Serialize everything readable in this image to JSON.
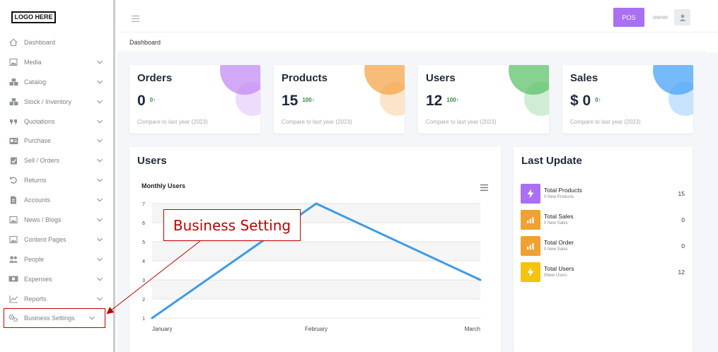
{
  "logo": "LOGO HERE",
  "sidebar": {
    "items": [
      {
        "label": "Dashboard",
        "icon": "home-icon",
        "has_chevron": false
      },
      {
        "label": "Media",
        "icon": "image-icon",
        "has_chevron": true
      },
      {
        "label": "Catalog",
        "icon": "boxes-icon",
        "has_chevron": true
      },
      {
        "label": "Stock / Inventory",
        "icon": "boxes-icon",
        "has_chevron": true
      },
      {
        "label": "Quotations",
        "icon": "quote-icon",
        "has_chevron": true
      },
      {
        "label": "Purchase",
        "icon": "id-card-icon",
        "has_chevron": true
      },
      {
        "label": "Sell / Orders",
        "icon": "clipboard-check-icon",
        "has_chevron": true
      },
      {
        "label": "Returns",
        "icon": "undo-icon",
        "has_chevron": true
      },
      {
        "label": "Accounts",
        "icon": "file-icon",
        "has_chevron": true
      },
      {
        "label": "News / Blogs",
        "icon": "image-icon",
        "has_chevron": true
      },
      {
        "label": "Content Pages",
        "icon": "image-icon",
        "has_chevron": true
      },
      {
        "label": "People",
        "icon": "users-icon",
        "has_chevron": true
      },
      {
        "label": "Expenses",
        "icon": "money-icon",
        "has_chevron": true
      },
      {
        "label": "Reports",
        "icon": "chart-line-icon",
        "has_chevron": true
      },
      {
        "label": "Business Settings",
        "icon": "cogs-icon",
        "has_chevron": true
      }
    ]
  },
  "topbar": {
    "pos_label": "POS",
    "user_label": "owner"
  },
  "breadcrumb": "Dashboard",
  "stats": [
    {
      "title": "Orders",
      "value": "0",
      "delta": "0↑",
      "footer": "Compare to last year (2023)",
      "color": "#c28cf4"
    },
    {
      "title": "Products",
      "value": "15",
      "delta": "100↑",
      "footer": "Compare to last year (2023)",
      "color": "#f4a64a"
    },
    {
      "title": "Users",
      "value": "12",
      "delta": "100↑",
      "footer": "Compare to last year (2023)",
      "color": "#5fc26c"
    },
    {
      "title": "Sales",
      "value": "$ 0",
      "delta": "0↑",
      "footer": "Compare to last year (2023)",
      "color": "#4aa3f7"
    }
  ],
  "users_panel": {
    "title": "Users",
    "chart_title": "Monthly Users"
  },
  "chart_data": {
    "type": "line",
    "categories": [
      "January",
      "February",
      "March"
    ],
    "series": [
      {
        "values": [
          1,
          7,
          3
        ]
      }
    ],
    "y_ticks": [
      "1",
      "2",
      "3",
      "4",
      "5",
      "6",
      "7"
    ],
    "ylim": [
      1,
      7
    ],
    "grid": true,
    "line_color": "#3d9be4"
  },
  "last_update": {
    "title": "Last Update",
    "rows": [
      {
        "name": "Total Products",
        "sub": "0 New Products",
        "value": "15",
        "color": "#a970f2",
        "icon": "bolt-icon"
      },
      {
        "name": "Total Sales",
        "sub": "0 New Sales",
        "value": "0",
        "color": "#f0a132",
        "icon": "bar-chart-icon"
      },
      {
        "name": "Total Order",
        "sub": "0 New Sales",
        "value": "0",
        "color": "#f0a132",
        "icon": "bar-chart-icon"
      },
      {
        "name": "Total Users",
        "sub": "0New Users",
        "value": "12",
        "color": "#f5c20d",
        "icon": "bolt-icon"
      }
    ]
  },
  "annotation": {
    "label": "Business Setting",
    "color": "#c00000"
  }
}
